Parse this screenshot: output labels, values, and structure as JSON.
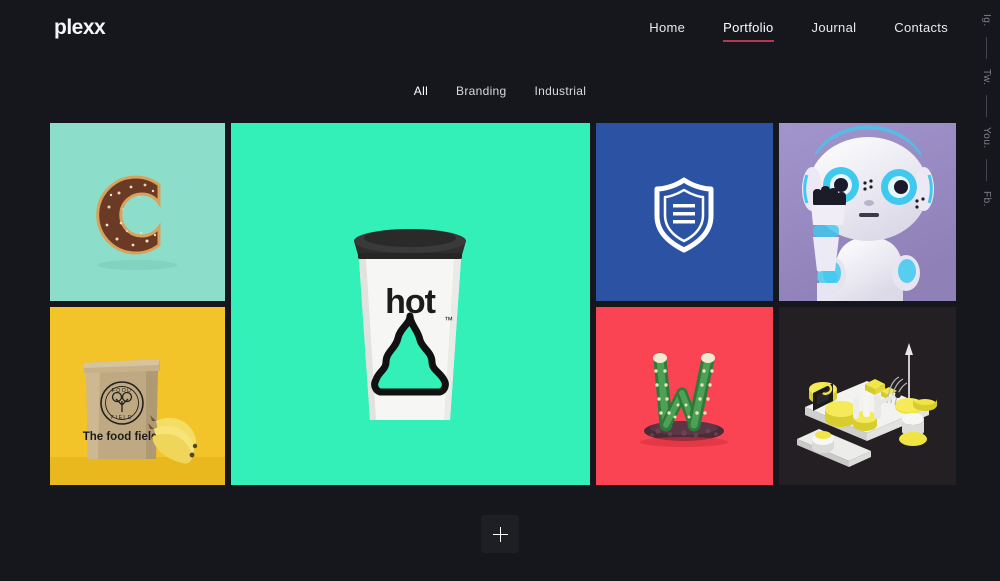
{
  "brand": {
    "logo_text": "plexx"
  },
  "nav": {
    "items": [
      {
        "label": "Home",
        "active": false
      },
      {
        "label": "Portfolio",
        "active": true
      },
      {
        "label": "Journal",
        "active": false
      },
      {
        "label": "Contacts",
        "active": false
      }
    ],
    "active_underline_color": "#b4384e"
  },
  "social": {
    "items": [
      {
        "label": "Ig."
      },
      {
        "label": "Tw."
      },
      {
        "label": "You."
      },
      {
        "label": "Fb."
      }
    ]
  },
  "filters": {
    "items": [
      {
        "label": "All",
        "active": true
      },
      {
        "label": "Branding",
        "active": false
      },
      {
        "label": "Industrial",
        "active": false
      }
    ]
  },
  "portfolio": {
    "tiles": [
      {
        "name": "donut-c",
        "subject": "chocolate-sprinkle-donut-letter-c",
        "background_color": "#8cdecb",
        "accent_color": "#5e3526"
      },
      {
        "name": "hot-coffee-cup",
        "subject": "paper-coffee-cup",
        "background_color": "#33efb8",
        "cup_label": "hot",
        "trademark": "™",
        "cup_body_color": "#f4f4f2",
        "lid_color": "#2b2b2b",
        "swirl_color": "#33efb8"
      },
      {
        "name": "shield-badge",
        "subject": "security-shield-icon",
        "background_color": "#2b52a3",
        "icon_color": "#ffffff"
      },
      {
        "name": "robot-portrait",
        "subject": "white-humanoid-robot",
        "background_color": "#9d8fc4",
        "accent_color": "#2fc4e8"
      },
      {
        "name": "food-field-bag",
        "subject": "kraft-paper-bag-with-bananas",
        "background_color": "#f2c429",
        "bag_tagline": "The food field.",
        "bag_logo_text": "FOOD FIELD",
        "bag_color": "#b9a383",
        "banana_color": "#f5de63"
      },
      {
        "name": "cactus-w",
        "subject": "cacti-forming-letter-w",
        "background_color": "#fa4453",
        "accent_color": "#3f8f45"
      },
      {
        "name": "isometric-render",
        "subject": "3d-isometric-yellow-white-objects",
        "background_color": "#241f22",
        "accent_color": "#f0e441"
      }
    ]
  },
  "load_more": {
    "icon": "plus-icon"
  }
}
